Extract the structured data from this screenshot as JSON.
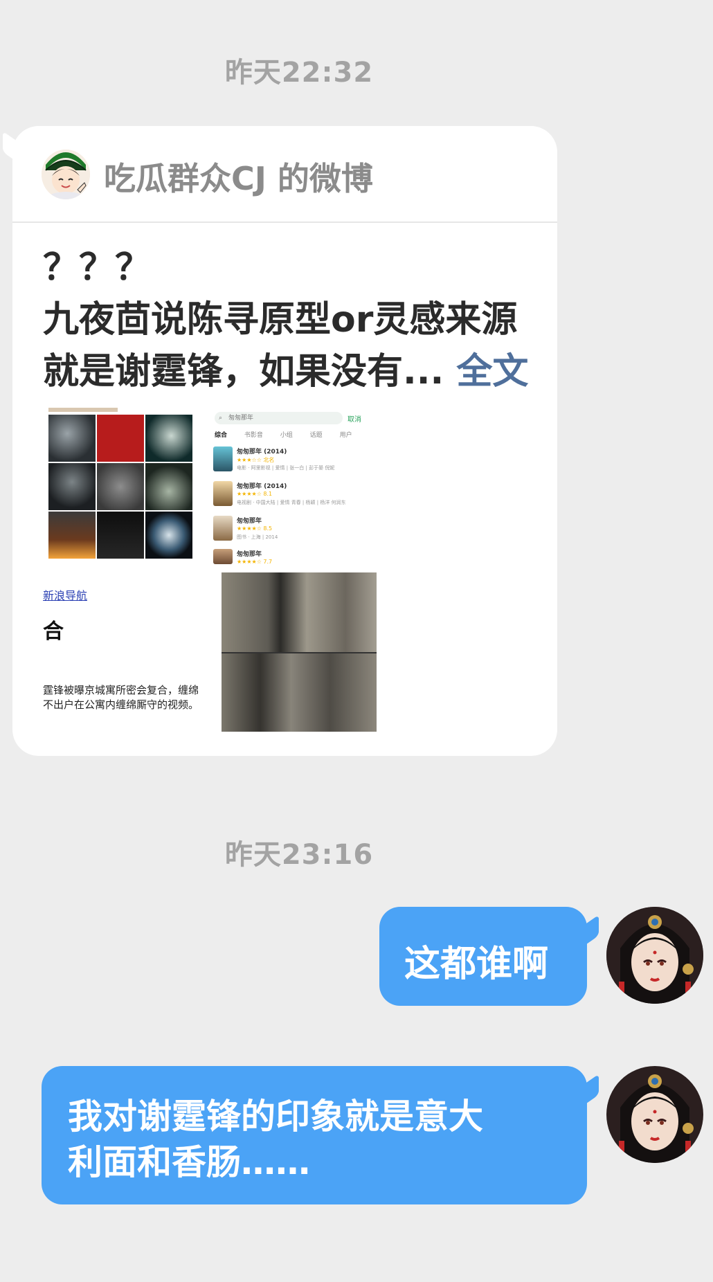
{
  "timestamps": {
    "first": "昨天22:32",
    "second": "昨天23:16"
  },
  "weibo_card": {
    "source": "吃瓜群众CJ 的微博",
    "lines": [
      "？？？",
      "九夜茴说陈寻原型or灵感来源",
      "就是谢霆锋，如果没有..."
    ],
    "full_text_link": "全文",
    "attachments": {
      "search_query": "匆匆那年",
      "cancel_label": "取消",
      "tabs": [
        "综合",
        "书影音",
        "小组",
        "话题",
        "用户"
      ],
      "results": [
        {
          "title": "匆匆那年 (2014)",
          "stars": "★★★☆☆ 北名",
          "meta": "电影 · 阿里影视 | 爱情 | 张一白 | 彭于晏 倪妮"
        },
        {
          "title": "匆匆那年 (2014)",
          "stars": "★★★★☆ 8.1",
          "meta": "电视剧 · 中国大陆 | 爱情 青春 | 杨颖 | 杨洋 何润东"
        },
        {
          "title": "匆匆那年",
          "stars": "★★★★☆ 8.5",
          "meta": "图书 · 上海 | 2014"
        },
        {
          "title": "匆匆那年",
          "stars": "★★★★☆ 7.7",
          "meta": ""
        }
      ],
      "nav_link": "新浪导航",
      "partial_glyph": "合",
      "news_line1": "霆锋被曝京城寓所密会复合，缠绵",
      "news_line2": "不出户在公寓内缠绵厮守的视频。"
    }
  },
  "messages": [
    {
      "text_lines": [
        "这都谁啊"
      ]
    },
    {
      "text_lines": [
        "我对谢霆锋的印象就是意大",
        "利面和香肠……"
      ]
    }
  ],
  "colors": {
    "background": "#ededed",
    "bubble": "#4ba3f6",
    "link": "#4f6f9b"
  }
}
